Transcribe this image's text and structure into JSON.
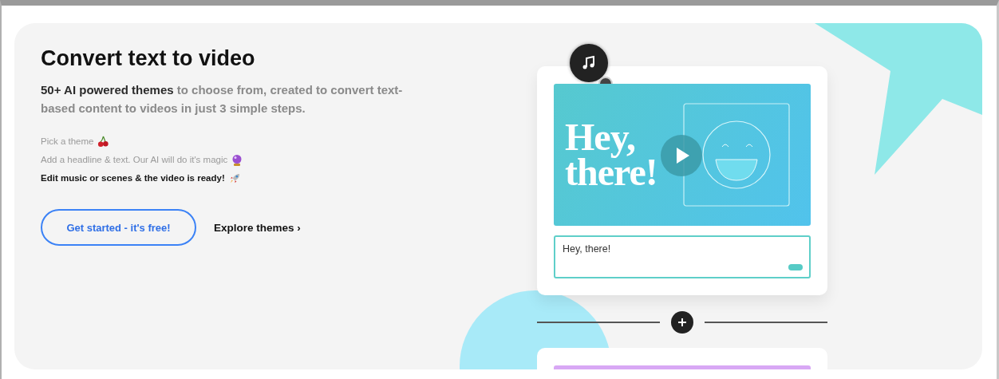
{
  "hero": {
    "title": "Convert text to video",
    "lead": "**50+ AI powered themes** to choose from, created to convert text-based content to videos in just 3 simple steps.",
    "steps": [
      {
        "label": "Pick a theme",
        "current": false
      },
      {
        "label": "Add a headline & text. Our AI will do it's magic",
        "current": false
      },
      {
        "label": "Edit music or scenes & the video is ready!",
        "current": true
      }
    ],
    "primary_button": "Get started - it's free!",
    "secondary_link": "Explore themes",
    "secondary_link_arrow": "›"
  },
  "preview": {
    "video_text": "Hey, there!",
    "text_field_value": "Hey, there!"
  }
}
